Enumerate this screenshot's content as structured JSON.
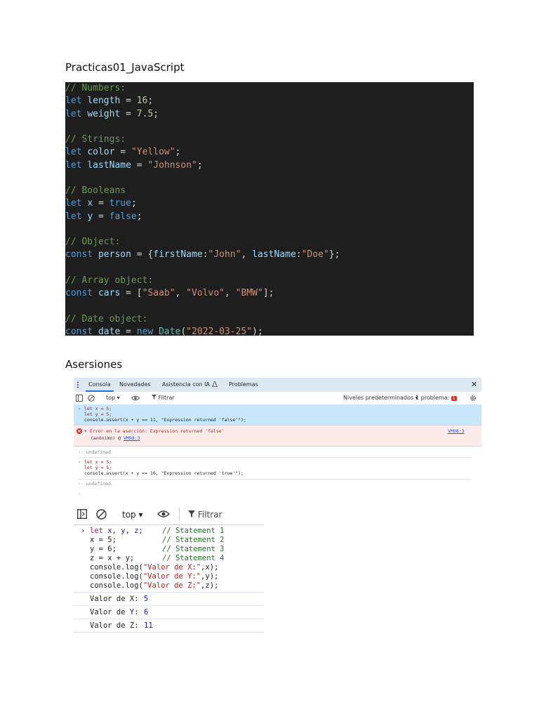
{
  "headings": {
    "section1": "Practicas01_JavaScript",
    "section2": "Asersiones"
  },
  "code_lines": [
    [
      {
        "t": "// Numbers:",
        "c": "c-com"
      }
    ],
    [
      {
        "t": "let ",
        "c": "c-kw"
      },
      {
        "t": "length",
        "c": "c-id"
      },
      {
        "t": " = ",
        "c": "c-op"
      },
      {
        "t": "16",
        "c": "c-num"
      },
      {
        "t": ";",
        "c": "c-op"
      }
    ],
    [
      {
        "t": "let ",
        "c": "c-kw"
      },
      {
        "t": "weight",
        "c": "c-id"
      },
      {
        "t": " = ",
        "c": "c-op"
      },
      {
        "t": "7.5",
        "c": "c-num"
      },
      {
        "t": ";",
        "c": "c-op"
      }
    ],
    [],
    [
      {
        "t": "// Strings:",
        "c": "c-com"
      }
    ],
    [
      {
        "t": "let ",
        "c": "c-kw"
      },
      {
        "t": "color",
        "c": "c-id"
      },
      {
        "t": " = ",
        "c": "c-op"
      },
      {
        "t": "\"Yellow\"",
        "c": "c-str"
      },
      {
        "t": ";",
        "c": "c-op"
      }
    ],
    [
      {
        "t": "let ",
        "c": "c-kw"
      },
      {
        "t": "lastName",
        "c": "c-id"
      },
      {
        "t": " = ",
        "c": "c-op"
      },
      {
        "t": "\"Johnson\"",
        "c": "c-str"
      },
      {
        "t": ";",
        "c": "c-op"
      }
    ],
    [],
    [
      {
        "t": "// Booleans",
        "c": "c-com"
      }
    ],
    [
      {
        "t": "let ",
        "c": "c-kw"
      },
      {
        "t": "x",
        "c": "c-id"
      },
      {
        "t": " = ",
        "c": "c-op"
      },
      {
        "t": "true",
        "c": "c-kw"
      },
      {
        "t": ";",
        "c": "c-op"
      }
    ],
    [
      {
        "t": "let ",
        "c": "c-kw"
      },
      {
        "t": "y",
        "c": "c-id"
      },
      {
        "t": " = ",
        "c": "c-op"
      },
      {
        "t": "false",
        "c": "c-kw"
      },
      {
        "t": ";",
        "c": "c-op"
      }
    ],
    [],
    [
      {
        "t": "// Object:",
        "c": "c-com"
      }
    ],
    [
      {
        "t": "const ",
        "c": "c-kw"
      },
      {
        "t": "person",
        "c": "c-id"
      },
      {
        "t": " = {",
        "c": "c-op"
      },
      {
        "t": "firstName",
        "c": "c-id"
      },
      {
        "t": ":",
        "c": "c-op"
      },
      {
        "t": "\"John\"",
        "c": "c-str"
      },
      {
        "t": ", ",
        "c": "c-op"
      },
      {
        "t": "lastName",
        "c": "c-id"
      },
      {
        "t": ":",
        "c": "c-op"
      },
      {
        "t": "\"Doe\"",
        "c": "c-str"
      },
      {
        "t": "};",
        "c": "c-op"
      }
    ],
    [],
    [
      {
        "t": "// Array object:",
        "c": "c-com"
      }
    ],
    [
      {
        "t": "const ",
        "c": "c-kw"
      },
      {
        "t": "cars",
        "c": "c-id"
      },
      {
        "t": " = [",
        "c": "c-op"
      },
      {
        "t": "\"Saab\"",
        "c": "c-str"
      },
      {
        "t": ", ",
        "c": "c-op"
      },
      {
        "t": "\"Volvo\"",
        "c": "c-str"
      },
      {
        "t": ", ",
        "c": "c-op"
      },
      {
        "t": "\"BMW\"",
        "c": "c-str"
      },
      {
        "t": "];",
        "c": "c-op"
      }
    ],
    [],
    [
      {
        "t": "// Date object:",
        "c": "c-com"
      }
    ],
    [
      {
        "t": "const ",
        "c": "c-kw"
      },
      {
        "t": "date",
        "c": "c-id"
      },
      {
        "t": " = ",
        "c": "c-op"
      },
      {
        "t": "new ",
        "c": "c-kw"
      },
      {
        "t": "Date",
        "c": "c-type"
      },
      {
        "t": "(",
        "c": "c-op"
      },
      {
        "t": "\"2022-03-25\"",
        "c": "c-str"
      },
      {
        "t": ");",
        "c": "c-op"
      }
    ]
  ],
  "devtools1": {
    "tabs": {
      "console": "Consola",
      "news": "Novedades",
      "ai": "Asistencia con IA",
      "problems": "Problemas"
    },
    "toolbar": {
      "context": "top",
      "filter_placeholder": "Filtrar",
      "levels": "Niveles predeterminados",
      "issues": "1 problema:",
      "issues_count": "1"
    },
    "entry1": [
      "let x = 5;",
      "let y = 5;",
      "console.assert(x + y == 11, \"Expression returned 'false'\");"
    ],
    "error": {
      "message": "Error en la aserción: Expression returned 'false'",
      "stack": "(anónimo) @ ",
      "stack_link": "VM98:3",
      "source": "VM98:3"
    },
    "undefined1": "undefined",
    "entry2": [
      "let x = 5;",
      "let y = 5;",
      "console.assert(x + y == 10, \"Expression returned 'true'\");"
    ],
    "undefined2": "undefined"
  },
  "devtools2": {
    "context": "top",
    "filter_placeholder": "Filtrar",
    "code": {
      "line1": {
        "kw": "let",
        "vars": " x, y, z;",
        "comment": "// Statement 1"
      },
      "line2": {
        "code": "x = 5;",
        "num": "",
        "comment": "// Statement 2"
      },
      "line3": {
        "code": "y = 6;",
        "comment": "// Statement 3"
      },
      "line4": {
        "code": "z = x + y;",
        "comment": "// Statement 4"
      },
      "line5": {
        "pre": "console.log(",
        "str": "\"Valor de X:\"",
        "post": ",x);"
      },
      "line6": {
        "pre": "console.log(",
        "str": "\"Valor de Y:\"",
        "post": ",y);"
      },
      "line7": {
        "pre": "console.log(",
        "str": "\"Valor de Z:\"",
        "post": ",z);"
      }
    },
    "outputs": [
      {
        "label": "Valor de X:",
        "value": "5"
      },
      {
        "label": "Valor de Y:",
        "value": "6"
      },
      {
        "label": "Valor de Z:",
        "value": "11"
      }
    ]
  }
}
